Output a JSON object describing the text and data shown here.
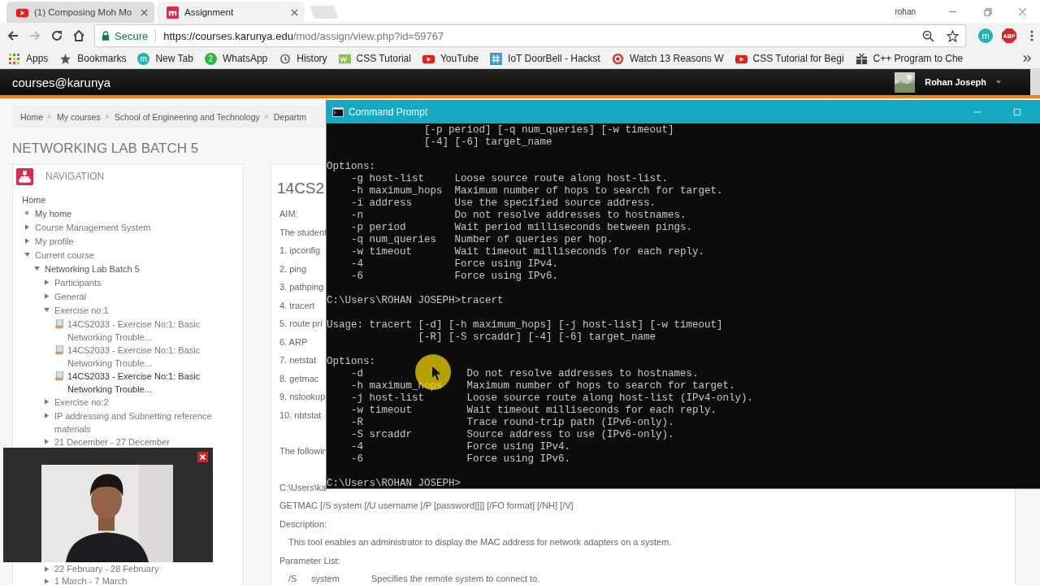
{
  "browser": {
    "tabs": [
      {
        "title": "(1) Composing Moh Mo",
        "selected": false
      },
      {
        "title": "Assignment",
        "selected": true
      }
    ],
    "profile": "rohan",
    "address": {
      "secure_label": "Secure",
      "host": "https://courses.karunya.edu",
      "path": "/mod/assign/view.php?id=59767"
    },
    "extensions": [
      {
        "kind": "circle",
        "label": "m"
      },
      {
        "kind": "octagon",
        "label": "ABP"
      }
    ],
    "bookmarks": [
      {
        "label": "Apps"
      },
      {
        "label": "Bookmarks"
      },
      {
        "label": "New Tab",
        "icon_text": "m"
      },
      {
        "label": "WhatsApp",
        "icon_text": "2"
      },
      {
        "label": "History"
      },
      {
        "label": "CSS Tutorial"
      },
      {
        "label": "YouTube"
      },
      {
        "label": "IoT DoorBell - Hackst"
      },
      {
        "label": "Watch 13 Reasons W"
      },
      {
        "label": "CSS Tutorial for Begi"
      },
      {
        "label": "C++ Program to Che"
      }
    ]
  },
  "site": {
    "name": "courses@karunya",
    "user": "Rohan Joseph"
  },
  "breadcrumb": [
    "Home",
    "My courses",
    "School of Engineering and Technology",
    "Departm"
  ],
  "course_title": "NETWORKING LAB BATCH 5",
  "navigation": {
    "title": "NAVIGATION",
    "items": [
      {
        "label": "Home",
        "kind": "root",
        "children": [
          {
            "label": "My home",
            "kind": "leaf"
          },
          {
            "label": "Course Management System",
            "kind": "branch",
            "expanded": false
          },
          {
            "label": "My profile",
            "kind": "branch",
            "expanded": false
          },
          {
            "label": "Current course",
            "kind": "branch",
            "expanded": true,
            "children": [
              {
                "label": "Networking Lab Batch 5",
                "kind": "branch",
                "expanded": true,
                "children": [
                  {
                    "label": "Participants",
                    "kind": "branch",
                    "expanded": false
                  },
                  {
                    "label": "General",
                    "kind": "branch",
                    "expanded": false
                  },
                  {
                    "label": "Exercise no:1",
                    "kind": "branch",
                    "expanded": true,
                    "children": [
                      {
                        "label": "14CS2033 - Exercise No:1: Basic Networking Trouble...",
                        "kind": "assignment",
                        "selected": false
                      },
                      {
                        "label": "14CS2033 - Exercise No:1: Basic Networking Trouble...",
                        "kind": "assignment",
                        "selected": false
                      },
                      {
                        "label": "14CS2033 - Exercise No:1: Basic Networking Trouble...",
                        "kind": "assignment",
                        "selected": true
                      }
                    ]
                  },
                  {
                    "label": "Exercise no:2",
                    "kind": "branch",
                    "expanded": false
                  },
                  {
                    "label": "IP addressing and Subnetting reference materials",
                    "kind": "branch",
                    "expanded": false
                  },
                  {
                    "label": "21 December - 27 December",
                    "kind": "branch",
                    "expanded": false
                  },
                  {
                    "label": "22 February - 28 February",
                    "kind": "branch",
                    "expanded": false
                  },
                  {
                    "label": "1 March - 7 March",
                    "kind": "branch",
                    "expanded": false
                  }
                ]
              }
            ]
          }
        ]
      }
    ]
  },
  "assignment": {
    "heading": "14CS2",
    "sections": [
      [
        {
          "kind": "text",
          "text": "AIM:"
        },
        {
          "kind": "text",
          "text": "The student"
        },
        {
          "kind": "text",
          "text": "1. ipconfig"
        },
        {
          "kind": "text",
          "text": "2. ping"
        },
        {
          "kind": "text",
          "text": "3. pathping"
        },
        {
          "kind": "text",
          "text": "4. tracert"
        },
        {
          "kind": "text",
          "text": "5. route pri"
        },
        {
          "kind": "text",
          "text": "6. ARP"
        },
        {
          "kind": "text",
          "text": "7. netstat"
        },
        {
          "kind": "text",
          "text": "8. getmac"
        },
        {
          "kind": "text",
          "text": "9. nslookup"
        },
        {
          "kind": "text",
          "text": "10. nbtstat"
        }
      ],
      [
        {
          "kind": "text",
          "text": "The followin"
        }
      ],
      [
        {
          "kind": "text",
          "text": "C:\\Users\\ka"
        },
        {
          "kind": "text",
          "text": "GETMAC [/S system [/U username [/P [password]]]] [/FO format] [/NH] [/V]"
        },
        {
          "kind": "text",
          "text": "Description:"
        },
        {
          "kind": "indent",
          "text": "This tool enables an administrator to display the MAC address for network adapters on a system."
        },
        {
          "kind": "text",
          "text": "Parameter List:"
        },
        {
          "kind": "param",
          "cells": [
            "/S",
            "system",
            "Specifies the remote system to connect to."
          ]
        }
      ]
    ]
  },
  "console": {
    "title": "Command Prompt",
    "blocks": [
      [
        "                [-p period] [-q num_queries] [-w timeout]",
        "                [-4] [-6] target_name"
      ],
      [
        "Options:",
        "    -g host-list     Loose source route along host-list.",
        "    -h maximum_hops  Maximum number of hops to search for target.",
        "    -i address       Use the specified source address.",
        "    -n               Do not resolve addresses to hostnames.",
        "    -p period        Wait period milliseconds between pings.",
        "    -q num_queries   Number of queries per hop.",
        "    -w timeout       Wait timeout milliseconds for each reply.",
        "    -4               Force using IPv4.",
        "    -6               Force using IPv6."
      ],
      [
        "C:\\Users\\ROHAN JOSEPH>tracert"
      ],
      [
        "Usage: tracert [-d] [-h maximum_hops] [-j host-list] [-w timeout]",
        "               [-R] [-S srcaddr] [-4] [-6] target_name"
      ],
      [
        "Options:",
        "    -d                 Do not resolve addresses to hostnames.",
        "    -h maximum_hops    Maximum number of hops to search for target.",
        "    -j host-list       Loose source route along host-list (IPv4-only).",
        "    -w timeout         Wait timeout milliseconds for each reply.",
        "    -R                 Trace round-trip path (IPv6-only).",
        "    -S srcaddr         Source address to use (IPv6-only).",
        "    -4                 Force using IPv4.",
        "    -6                 Force using IPv6."
      ],
      [
        "C:\\Users\\ROHAN JOSEPH>"
      ]
    ]
  }
}
